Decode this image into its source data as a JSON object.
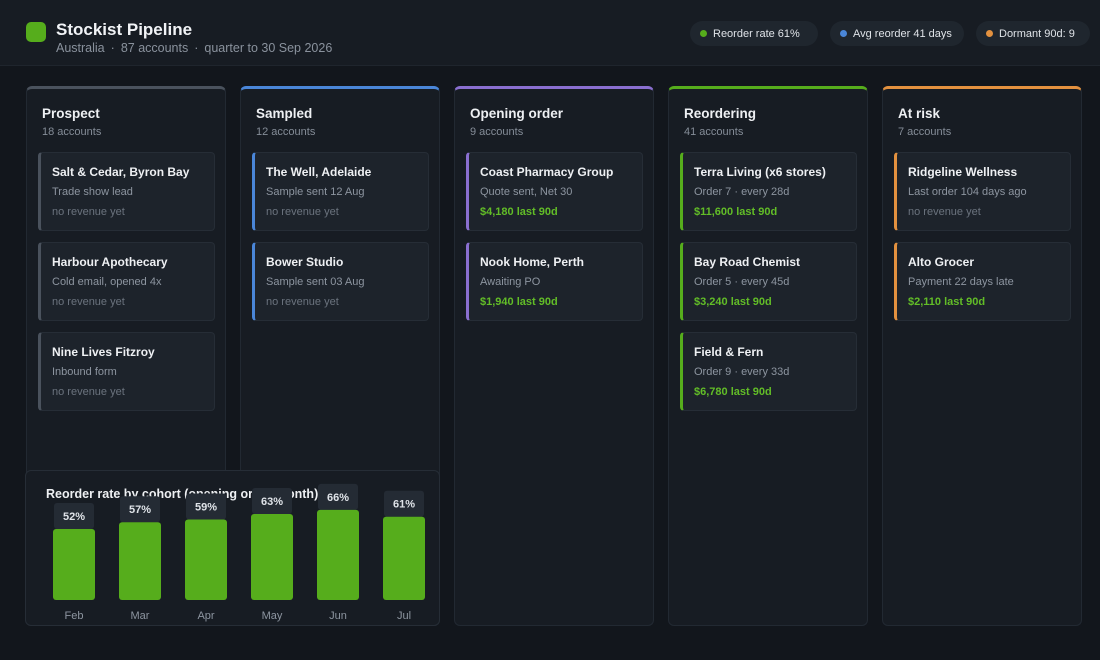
{
  "app": {
    "title": "Stockist Pipeline",
    "region": "Australia",
    "accounts": "87 accounts",
    "period": "quarter to 30 Sep 2026",
    "separator": "·"
  },
  "stats": [
    {
      "label": "Reorder rate 61%",
      "color": "#56ad1c"
    },
    {
      "label": "Avg reorder 41 days",
      "color": "#4a86d8"
    },
    {
      "label": "Dormant 90d: 9",
      "color": "#e3913f"
    }
  ],
  "columns": [
    {
      "title": "Prospect",
      "count": "18 accounts",
      "accent": "#4a525d",
      "cards": [
        {
          "name": "Salt & Cedar, Byron Bay",
          "detail": "Trade show lead",
          "revenue": "no revenue yet"
        },
        {
          "name": "Harbour Apothecary",
          "detail": "Cold email, opened 4x",
          "revenue": "no revenue yet"
        },
        {
          "name": "Nine Lives Fitzroy",
          "detail": "Inbound form",
          "revenue": "no revenue yet"
        }
      ]
    },
    {
      "title": "Sampled",
      "count": "12 accounts",
      "accent": "#4a86d8",
      "cards": [
        {
          "name": "The Well, Adelaide",
          "detail": "Sample sent 12 Aug",
          "revenue": "no revenue yet"
        },
        {
          "name": "Bower Studio",
          "detail": "Sample sent 03 Aug",
          "revenue": "no revenue yet"
        }
      ]
    },
    {
      "title": "Opening order",
      "count": "9 accounts",
      "accent": "#8a6fd0",
      "cards": [
        {
          "name": "Coast Pharmacy Group",
          "detail": "Quote sent, Net 30",
          "revenue": "$4,180 last 90d"
        },
        {
          "name": "Nook Home, Perth",
          "detail": "Awaiting PO",
          "revenue": "$1,940 last 90d"
        }
      ]
    },
    {
      "title": "Reordering",
      "count": "41 accounts",
      "accent": "#56ad1c",
      "cards": [
        {
          "name": "Terra Living (x6 stores)",
          "detail": "Order 7  ·  every 28d",
          "revenue": "$11,600 last 90d"
        },
        {
          "name": "Bay Road Chemist",
          "detail": "Order 5  ·  every 45d",
          "revenue": "$3,240 last 90d"
        },
        {
          "name": "Field & Fern",
          "detail": "Order 9  ·  every 33d",
          "revenue": "$6,780 last 90d"
        }
      ]
    },
    {
      "title": "At risk",
      "count": "7 accounts",
      "accent": "#e3913f",
      "cards": [
        {
          "name": "Ridgeline Wellness",
          "detail": "Last order 104 days ago",
          "revenue": "no revenue yet"
        },
        {
          "name": "Alto Grocer",
          "detail": "Payment 22 days late",
          "revenue": "$2,110 last 90d"
        }
      ]
    }
  ],
  "chart_data": {
    "type": "bar",
    "title": "Reorder rate by cohort (opening order month)",
    "categories": [
      "Feb",
      "Mar",
      "Apr",
      "May",
      "Jun",
      "Jul"
    ],
    "values": [
      52,
      57,
      59,
      63,
      66,
      61
    ],
    "value_labels": [
      "52%",
      "57%",
      "59%",
      "63%",
      "66%",
      "61%"
    ],
    "ylim": [
      0,
      70
    ],
    "bar_color": "#56ad1c"
  }
}
